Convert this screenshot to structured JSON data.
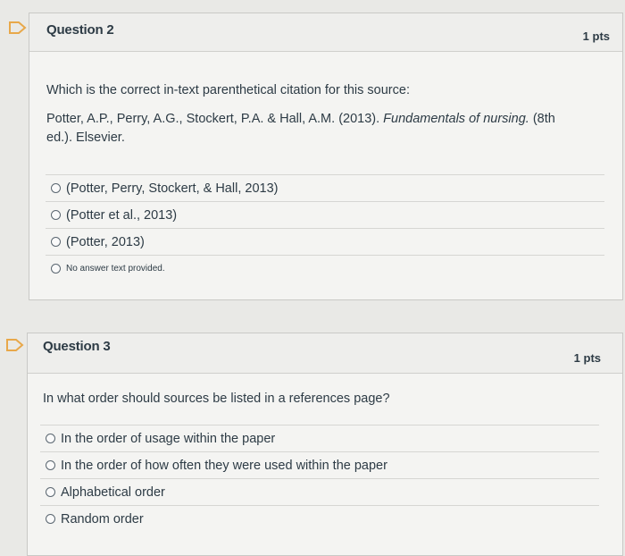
{
  "questions": [
    {
      "title": "Question 2",
      "points": "1 pts",
      "prompt": "Which is the correct in-text parenthetical citation for this source:",
      "source_pre": "Potter, A.P., Perry, A.G., Stockert, P.A. & Hall, A.M. (2013). ",
      "source_italic": "Fundamentals of nursing.",
      "source_post": " (8th",
      "source_line2": "ed.). Elsevier.",
      "answers": [
        "(Potter, Perry, Stockert, & Hall, 2013)",
        "(Potter et al., 2013)",
        "(Potter, 2013)",
        "No answer text provided."
      ]
    },
    {
      "title": "Question 3",
      "points": "1 pts",
      "prompt": "In what order should sources be listed in a references page?",
      "answers": [
        "In the order of usage within the paper",
        "In the order of how often they were used within the paper",
        "Alphabetical order",
        "Random order"
      ]
    }
  ],
  "colors": {
    "flag_outline": "#e8a84a",
    "text": "#2d3b45",
    "panel": "#f4f4f2",
    "border": "#c9c9c6"
  },
  "icons": {
    "flag": "flag-outline-icon",
    "radio": "radio-unchecked-icon"
  }
}
